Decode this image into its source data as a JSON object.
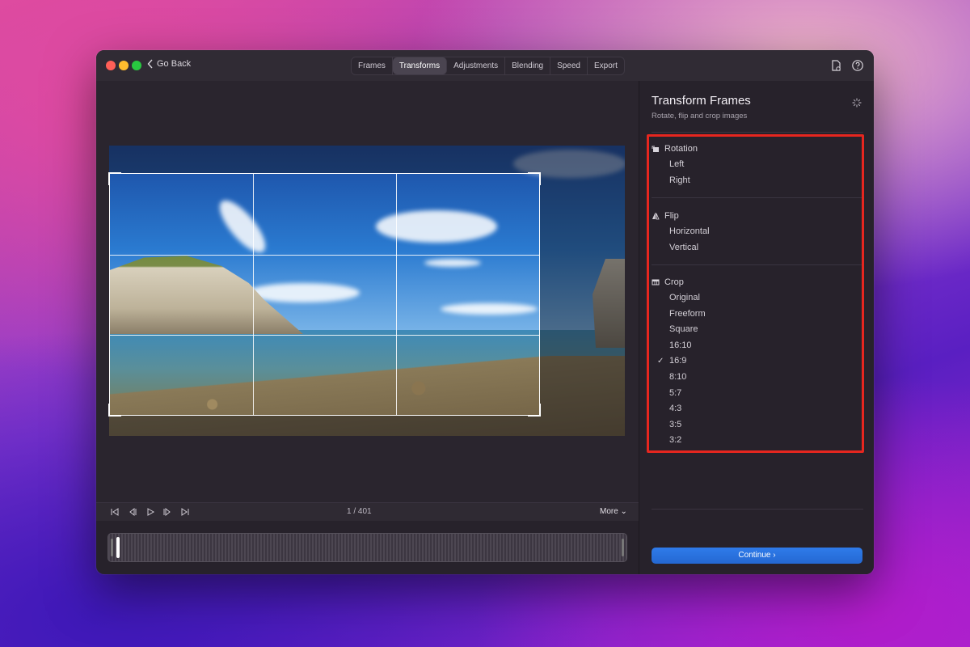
{
  "window": {
    "back_label": "Go Back",
    "tabs": [
      {
        "label": "Frames"
      },
      {
        "label": "Transforms",
        "active": true
      },
      {
        "label": "Adjustments"
      },
      {
        "label": "Blending"
      },
      {
        "label": "Speed"
      },
      {
        "label": "Export"
      }
    ],
    "icons": [
      "share-file-icon",
      "help-icon"
    ]
  },
  "player": {
    "counter": "1 / 401",
    "more_label": "More ⌄",
    "controls": [
      "skip-start-icon",
      "step-back-icon",
      "play-icon",
      "step-forward-icon",
      "skip-end-icon"
    ]
  },
  "panel": {
    "title": "Transform Frames",
    "subtitle": "Rotate, flip and crop images",
    "rotation": {
      "label": "Rotation",
      "options": [
        "Left",
        "Right"
      ]
    },
    "flip": {
      "label": "Flip",
      "options": [
        "Horizontal",
        "Vertical"
      ]
    },
    "crop": {
      "label": "Crop",
      "options": [
        "Original",
        "Freeform",
        "Square",
        "16:10",
        "16:9",
        "8:10",
        "5:7",
        "4:3",
        "3:5",
        "3:2"
      ],
      "selected": "16:9"
    },
    "continue_label": "Continue ›"
  },
  "colors": {
    "accent": "#2a72e0",
    "highlight": "#e6261f"
  }
}
